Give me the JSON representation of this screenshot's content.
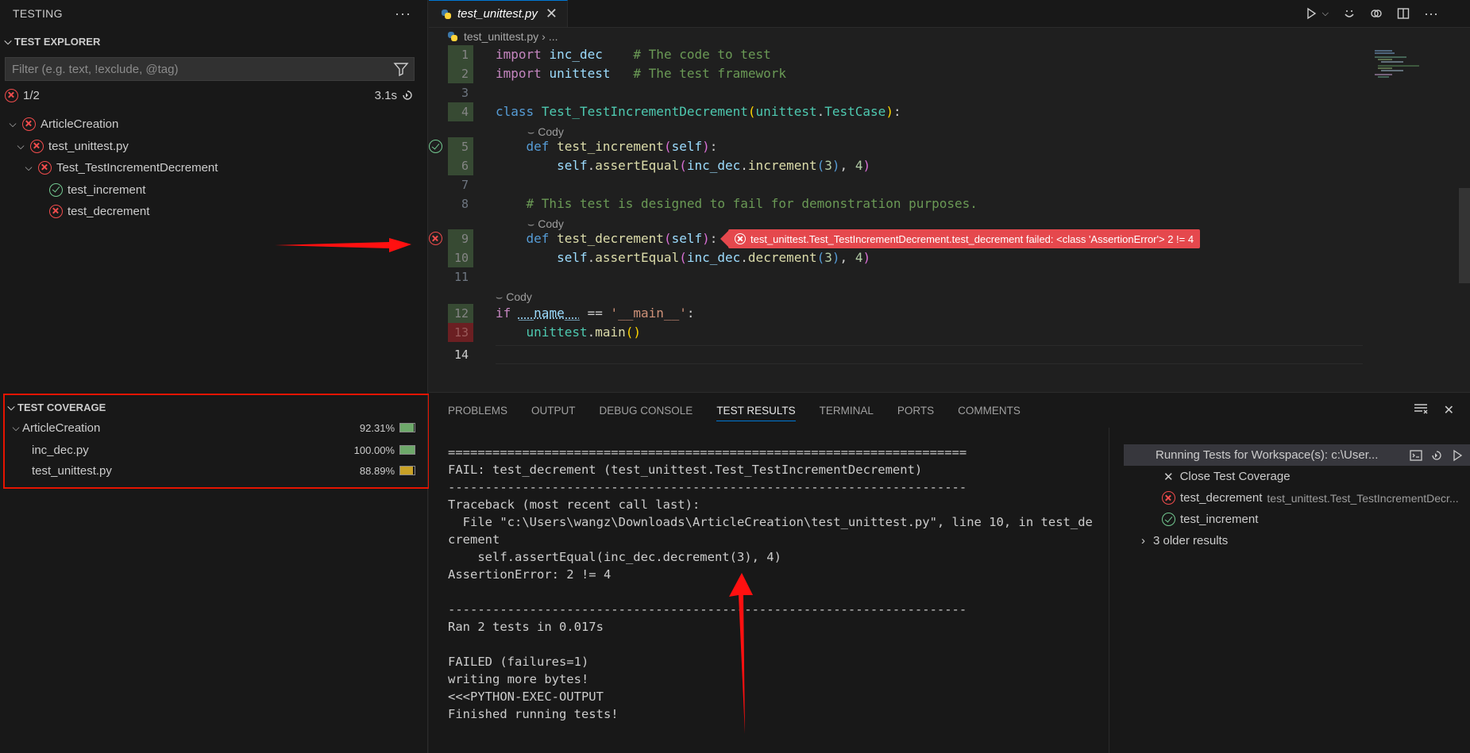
{
  "sidebar": {
    "header": "TESTING",
    "explorer_title": "TEST EXPLORER",
    "filter_placeholder": "Filter (e.g. text, !exclude, @tag)",
    "summary_count": "1/2",
    "summary_duration": "3.1s",
    "tree": [
      {
        "label": "ArticleCreation",
        "status": "fail",
        "depth": 0
      },
      {
        "label": "test_unittest.py",
        "status": "fail",
        "depth": 1
      },
      {
        "label": "Test_TestIncrementDecrement",
        "status": "fail",
        "depth": 2
      },
      {
        "label": "test_increment",
        "status": "pass",
        "depth": 3
      },
      {
        "label": "test_decrement",
        "status": "fail",
        "depth": 3
      }
    ],
    "coverage_title": "TEST COVERAGE",
    "coverage": [
      {
        "label": "ArticleCreation",
        "pct": "92.31%",
        "value": 0.9231,
        "color": "#6ea96a"
      },
      {
        "label": "inc_dec.py",
        "pct": "100.00%",
        "value": 1.0,
        "color": "#6ea96a"
      },
      {
        "label": "test_unittest.py",
        "pct": "88.89%",
        "value": 0.8889,
        "color": "#c9a227"
      }
    ]
  },
  "editor": {
    "tab_label": "test_unittest.py",
    "breadcrumb_file": "test_unittest.py",
    "breadcrumb_rest": "...",
    "codelens_label": "Cody",
    "line_numbers": [
      "1",
      "2",
      "3",
      "4",
      "5",
      "6",
      "7",
      "8",
      "9",
      "10",
      "11",
      "12",
      "13",
      "14"
    ],
    "code": {
      "l1_kw": "import",
      "l1_mod": "inc_dec",
      "l1_cm": "# The code to test",
      "l2_kw": "import",
      "l2_mod": "unittest",
      "l2_cm": "# The test framework",
      "l4_kw": "class",
      "l4_cls": "Test_TestIncrementDecrement",
      "l4_base1": "unittest",
      "l4_base2": "TestCase",
      "l5_kw": "def",
      "l5_fn": "test_increment",
      "l5_self": "self",
      "l6_self": "self",
      "l6_fn": "assertEqual",
      "l6_mod": "inc_dec",
      "l6_call": "increment",
      "l6_arg": "3",
      "l6_exp": "4",
      "l8_cm": "# This test is designed to fail for demonstration purposes.",
      "l9_kw": "def",
      "l9_fn": "test_decrement",
      "l9_self": "self",
      "l10_self": "self",
      "l10_fn": "assertEqual",
      "l10_mod": "inc_dec",
      "l10_call": "decrement",
      "l10_arg": "3",
      "l10_exp": "4",
      "l12_kw": "if",
      "l12_var": "__name__",
      "l12_str": "'__main__'",
      "l13_mod": "unittest",
      "l13_fn": "main"
    },
    "fail_message": "test_unittest.Test_TestIncrementDecrement.test_decrement failed: <class 'AssertionError'> 2 != 4"
  },
  "panel": {
    "tabs": [
      "PROBLEMS",
      "OUTPUT",
      "DEBUG CONSOLE",
      "TEST RESULTS",
      "TERMINAL",
      "PORTS",
      "COMMENTS"
    ],
    "active_tab": "TEST RESULTS",
    "output_lines": [
      "======================================================================",
      "FAIL: test_decrement (test_unittest.Test_TestIncrementDecrement)",
      "----------------------------------------------------------------------",
      "Traceback (most recent call last):",
      "  File \"c:\\Users\\wangz\\Downloads\\ArticleCreation\\test_unittest.py\", line 10, in test_de",
      "crement",
      "    self.assertEqual(inc_dec.decrement(3), 4)",
      "AssertionError: 2 != 4",
      "",
      "----------------------------------------------------------------------",
      "Ran 2 tests in 0.017s",
      "",
      "FAILED (failures=1)",
      "writing more bytes!",
      "<<<PYTHON-EXEC-OUTPUT",
      "Finished running tests!"
    ],
    "results": {
      "run_label": "Running Tests for Workspace(s): c:\\User...",
      "close_coverage": "Close Test Coverage",
      "fail_item": "test_decrement",
      "fail_item_sub": "test_unittest.Test_TestIncrementDecr...",
      "pass_item": "test_increment",
      "older": "3 older results"
    }
  }
}
